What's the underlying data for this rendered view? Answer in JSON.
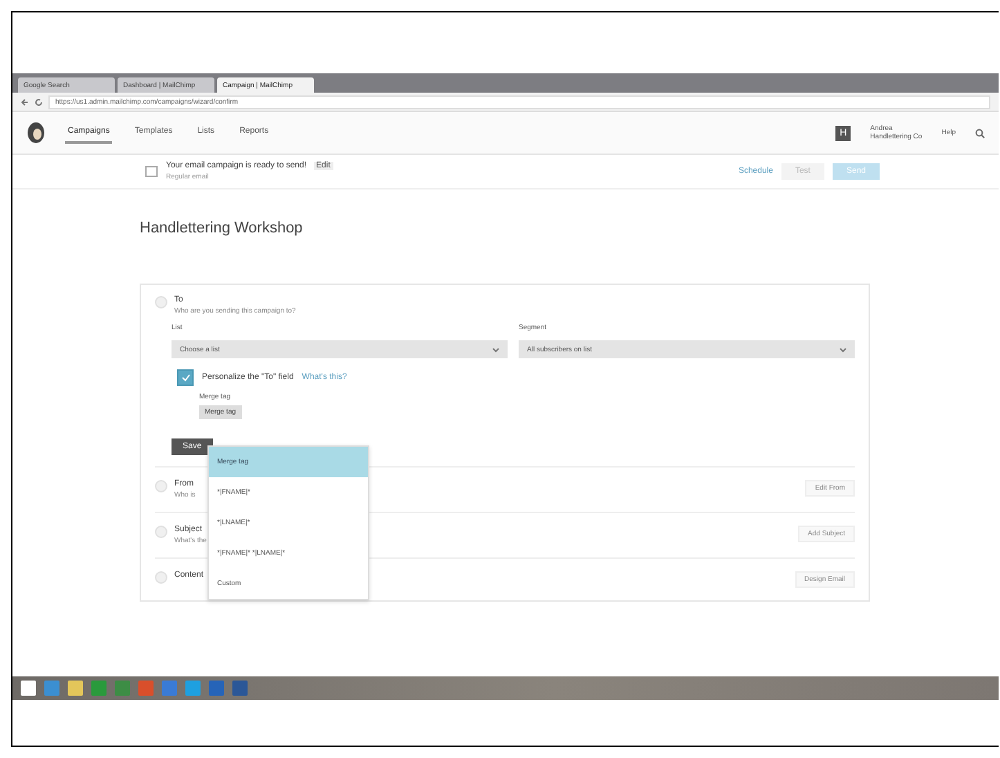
{
  "browser": {
    "tabs": [
      {
        "title": "Google Search",
        "selected": false
      },
      {
        "title": "Dashboard | MailChimp",
        "selected": false
      },
      {
        "title": "Campaign | MailChimp",
        "selected": true
      }
    ],
    "url": "https://us1.admin.mailchimp.com/campaigns/wizard/confirm"
  },
  "nav": {
    "items": [
      {
        "label": "Campaigns",
        "selected": true
      },
      {
        "label": "Templates",
        "selected": false
      },
      {
        "label": "Lists",
        "selected": false
      },
      {
        "label": "Reports",
        "selected": false
      }
    ],
    "account_initial": "H",
    "account_name": "Andrea",
    "account_org": "Handlettering Co",
    "help": "Help"
  },
  "notice": {
    "message": "Your email campaign is ready to send!",
    "edit": "Edit",
    "subtitle": "Regular email",
    "link": "Schedule",
    "buttons": [
      {
        "label": "Test",
        "kind": "plain"
      },
      {
        "label": "Send",
        "kind": "primary"
      }
    ]
  },
  "title": "Handlettering Workshop",
  "to": {
    "heading": "To",
    "description": "Who are you sending this campaign to?",
    "list_label": "List",
    "list_value": "Choose a list",
    "segment_label": "Segment",
    "segment_value": "All subscribers on list",
    "personalize": {
      "label": "Personalize the \"To\" field",
      "checked": true
    },
    "help_link": "What's this?",
    "merge_label": "Merge tag",
    "merge_value": "Merge tag",
    "save": "Save"
  },
  "merge_menu": [
    {
      "label": "Merge tag",
      "selected": true
    },
    {
      "label": "*|FNAME|*",
      "selected": false
    },
    {
      "label": "*|LNAME|*",
      "selected": false
    },
    {
      "label": "*|FNAME|* *|LNAME|*",
      "selected": false
    },
    {
      "label": "Custom",
      "selected": false
    }
  ],
  "sections": [
    {
      "heading": "From",
      "description": "Who is",
      "button": "Edit From"
    },
    {
      "heading": "Subject",
      "description": "What's the",
      "button": "Add Subject"
    },
    {
      "heading": "Content",
      "button": "Design Email"
    }
  ]
}
